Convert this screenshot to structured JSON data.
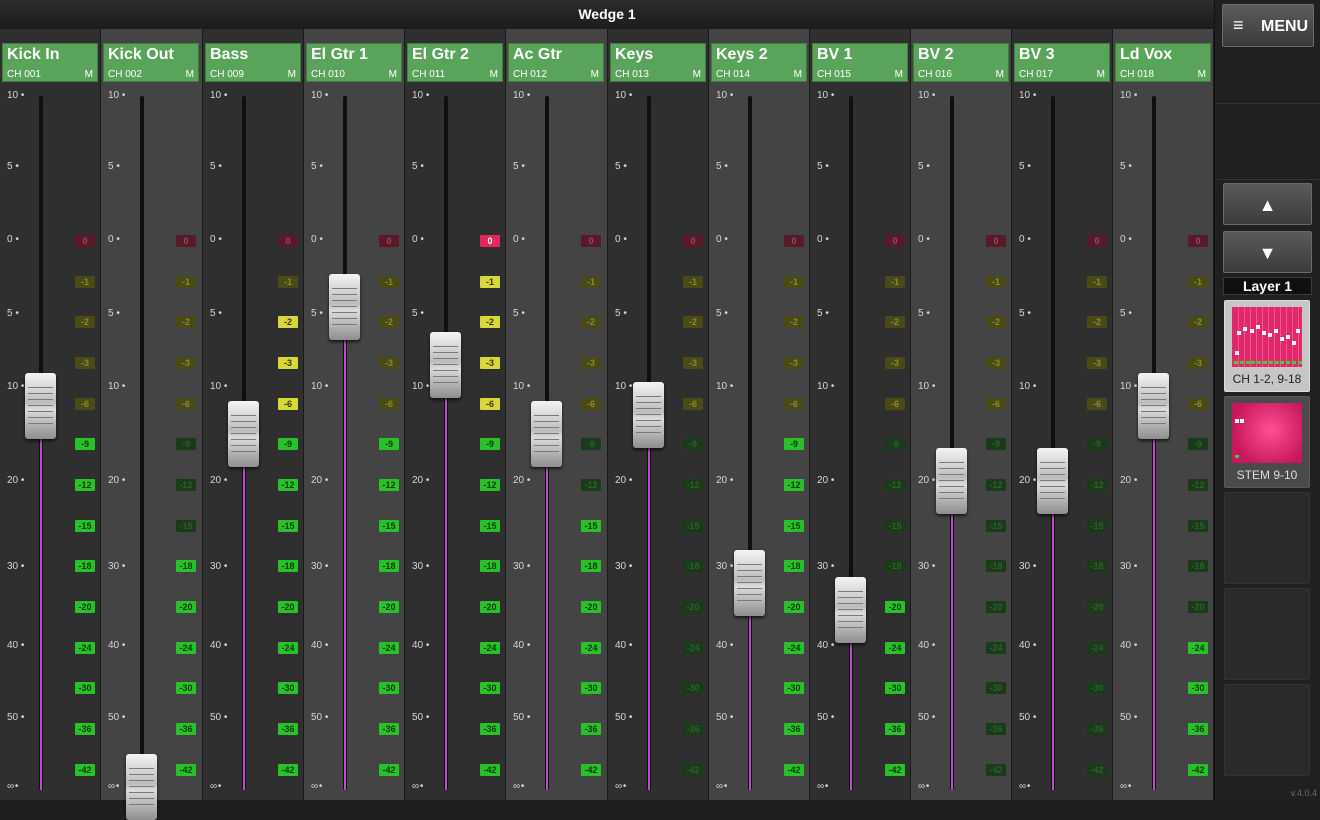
{
  "window": {
    "title": "Wedge 1"
  },
  "scale_labels": [
    "10",
    "5",
    "0",
    "5",
    "10",
    "20",
    "30",
    "40",
    "50"
  ],
  "led_labels": [
    "0",
    "-1",
    "-2",
    "-3",
    "-6",
    "-9",
    "-12",
    "-15",
    "-18",
    "-20",
    "-24",
    "-30",
    "-36",
    "-42"
  ],
  "infinity_label": "∞",
  "channels": [
    {
      "name": "Kick In",
      "ch": "CH 001",
      "mute": "M",
      "fader_db": -12,
      "meter_lit": 9
    },
    {
      "name": "Kick Out",
      "ch": "CH 002",
      "mute": "M",
      "fader_db": -100,
      "meter_lit": 6
    },
    {
      "name": "Bass",
      "ch": "CH 009",
      "mute": "M",
      "fader_db": -15,
      "meter_lit": 12
    },
    {
      "name": "El Gtr 1",
      "ch": "CH 010",
      "mute": "M",
      "fader_db": -4.5,
      "meter_lit": 9
    },
    {
      "name": "El Gtr 2",
      "ch": "CH 011",
      "mute": "M",
      "fader_db": -8.5,
      "meter_lit": 14
    },
    {
      "name": "Ac Gtr",
      "ch": "CH 012",
      "mute": "M",
      "fader_db": -15,
      "meter_lit": 7
    },
    {
      "name": "Keys",
      "ch": "CH 013",
      "mute": "M",
      "fader_db": -13,
      "meter_lit": 0
    },
    {
      "name": "Keys 2",
      "ch": "CH 014",
      "mute": "M",
      "fader_db": -32,
      "meter_lit": 9
    },
    {
      "name": "BV 1",
      "ch": "CH 015",
      "mute": "M",
      "fader_db": -35.5,
      "meter_lit": 5
    },
    {
      "name": "BV 2",
      "ch": "CH 016",
      "mute": "M",
      "fader_db": -20,
      "meter_lit": 0
    },
    {
      "name": "BV 3",
      "ch": "CH 017",
      "mute": "M",
      "fader_db": -20,
      "meter_lit": 0
    },
    {
      "name": "Ld Vox",
      "ch": "CH 018",
      "mute": "M",
      "fader_db": -12,
      "meter_lit": 4
    }
  ],
  "sidebar": {
    "menu_icon": "≡",
    "menu_label": "MENU",
    "up_arrow": "▲",
    "down_arrow": "▼",
    "layer_label": "Layer 1",
    "layers": [
      {
        "label": "CH 1-2, 9-18",
        "selected": true
      },
      {
        "label": "STEM 9-10",
        "selected": false
      }
    ],
    "version": "v.4.0.4"
  },
  "colors": {
    "header_green": "#5aa35a",
    "level_magenta": "#c04bd0",
    "meter_red": "#e2275c",
    "meter_yellow": "#d8d83a",
    "meter_green": "#28c228"
  }
}
